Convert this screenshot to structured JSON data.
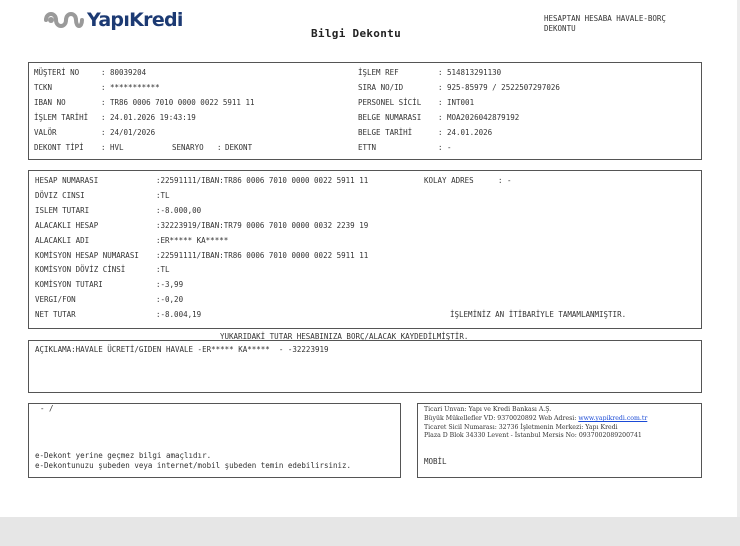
{
  "logo": {
    "brand": "YapıKredi"
  },
  "title": "Bilgi Dekontu",
  "header_note": {
    "line1": "HESAPTAN HESABA HAVALE-BORÇ",
    "line2": "DEKONTU"
  },
  "info": {
    "left": [
      {
        "label": "MÜŞTERİ NO",
        "value": "80039204"
      },
      {
        "label": "TCKN",
        "value": "***********"
      },
      {
        "label": "IBAN NO",
        "value": "TR86 0006 7010 0000 0022 5911 11"
      },
      {
        "label": "İŞLEM TARİHİ",
        "value": "24.01.2026 19:43:19"
      },
      {
        "label": "VALÖR",
        "value": "24/01/2026"
      },
      {
        "label": "DEKONT TİPİ",
        "value": "HVL"
      }
    ],
    "senaryo_label": "SENARYO",
    "senaryo_value": "DEKONT",
    "right": [
      {
        "label": "İŞLEM REF",
        "value": "514813291130"
      },
      {
        "label": "SIRA NO/ID",
        "value": "925-85979 / 2522507297026"
      },
      {
        "label": "PERSONEL SİCİL",
        "value": "INT001"
      },
      {
        "label": "BELGE NUMARASI",
        "value": "MOA2026042879192"
      },
      {
        "label": "BELGE TARİHİ",
        "value": "24.01.2026"
      },
      {
        "label": "ETTN",
        "value": "-"
      }
    ]
  },
  "details": [
    {
      "label": "HESAP NUMARASI",
      "value": "22591111/IBAN:TR86 0006 7010 0000 0022 5911 11"
    },
    {
      "label": "DÖVIZ CINSI",
      "value": "TL"
    },
    {
      "label": "ISLEM TUTARI",
      "value": "-8.000,00"
    },
    {
      "label": "ALACAKLI HESAP",
      "value": "32223919/IBAN:TR79 0006 7010 0000 0032 2239 19"
    },
    {
      "label": "ALACAKLI ADI",
      "value": "ER***** KA*****"
    },
    {
      "label": "KOMİSYON HESAP NUMARASI",
      "value": "22591111/IBAN:TR86 0006 7010 0000 0022 5911 11"
    },
    {
      "label": "KOMİSYON DÖVİZ CİNSİ",
      "value": "TL"
    },
    {
      "label": "KOMİSYON TUTARI",
      "value": "-3,99"
    },
    {
      "label": "VERGI/FON",
      "value": "-0,20"
    },
    {
      "label": "NET TUTAR",
      "value": "-8.004,19"
    }
  ],
  "kolay_adres": {
    "label": "KOLAY ADRES",
    "value": "-"
  },
  "completion_note": "İŞLEMİNİZ AN İTİBARİYLE TAMAMLANMIŞTIR.",
  "center_note": "YUKARIDAKİ TUTAR HESABINIZA BORÇ/ALACAK KAYDEDİLMİŞTİR.",
  "aciklama": "AÇIKLAMA:HAVALE ÜCRETİ/GIDEN HAVALE -ER***** KA*****  - -32223919",
  "bottom_left": {
    "dash": "- /",
    "line1": "e-Dekont yerine geçmez bilgi amaçlıdır.",
    "line2": "e-Dekontunuzu şubeden veya internet/mobil şubeden temin edebilirsiniz."
  },
  "bank_info": {
    "line1": "Ticari Unvan: Yapı ve Kredi Bankası A.Ş.",
    "line2_prefix": "Büyük Mükellefler VD: 9370020892 Web Adresi: ",
    "web": "www.yapikredi.com.tr",
    "line3": "Ticaret Sicil Numarası: 32736 İşletmenin Merkezi: Yapı Kredi",
    "line4": "Plaza D Blok 34330 Levent - İstanbul Mersis No: 0937002089200741",
    "mobil": "MOBİL"
  },
  "colors": {
    "brand_navy": "#1c3a73",
    "brand_gray": "#9a9a9a",
    "link": "#1a4ad6"
  }
}
